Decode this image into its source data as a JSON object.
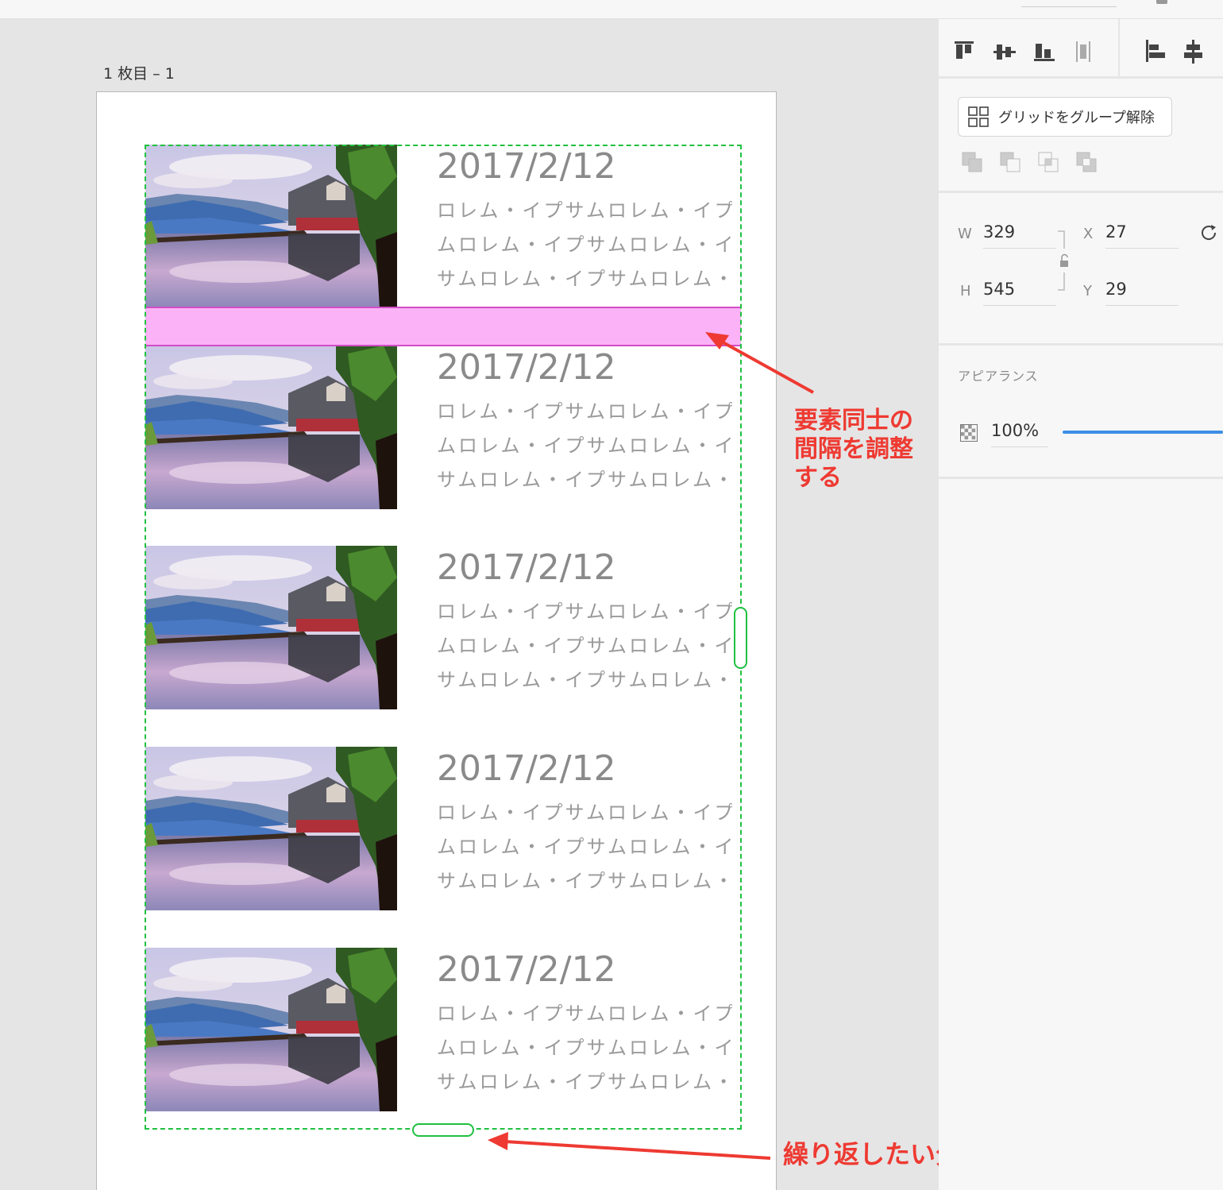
{
  "canvas": {
    "artboard_label": "1 枚目 – 1",
    "cards": [
      {
        "date": "2017/2/12",
        "lines": [
          "ロレム・イプサムロレム・イプサ",
          "ムロレム・イプサムロレム・イプ",
          "サムロレム・イプサムロレム・イ"
        ]
      },
      {
        "date": "2017/2/12",
        "lines": [
          "ロレム・イプサムロレム・イプサ",
          "ムロレム・イプサムロレム・イプ",
          "サムロレム・イプサムロレム・イ"
        ]
      },
      {
        "date": "2017/2/12",
        "lines": [
          "ロレム・イプサムロレム・イプサ",
          "ムロレム・イプサムロレム・イプ",
          "サムロレム・イプサムロレム・イ"
        ]
      },
      {
        "date": "2017/2/12",
        "lines": [
          "ロレム・イプサムロレム・イプサ",
          "ムロレム・イプサムロレム・イプ",
          "サムロレム・イプサムロレム・イ"
        ]
      },
      {
        "date": "2017/2/12",
        "lines": [
          "ロレム・イプサムロレム・イプサ",
          "ムロレム・イプサムロレム・イプ",
          "サムロレム・イプサムロレム・イ"
        ]
      }
    ]
  },
  "annotations": {
    "gap_note": [
      "要素同士の",
      "間隔を調整",
      "する"
    ],
    "drag_note": "繰り返したい分まで下にドラッグ",
    "color": "#ee3a32"
  },
  "panel": {
    "ungroup_label": "グリッドをグループ解除",
    "w_label": "W",
    "w_value": "329",
    "h_label": "H",
    "h_value": "545",
    "x_label": "X",
    "x_value": "27",
    "y_label": "Y",
    "y_value": "29",
    "appearance_title": "アピアランス",
    "opacity_value": "100%"
  },
  "colors": {
    "selection_green": "#20c040",
    "gap_pink": "#fbb2f6",
    "slider_blue": "#3d8fe5"
  }
}
